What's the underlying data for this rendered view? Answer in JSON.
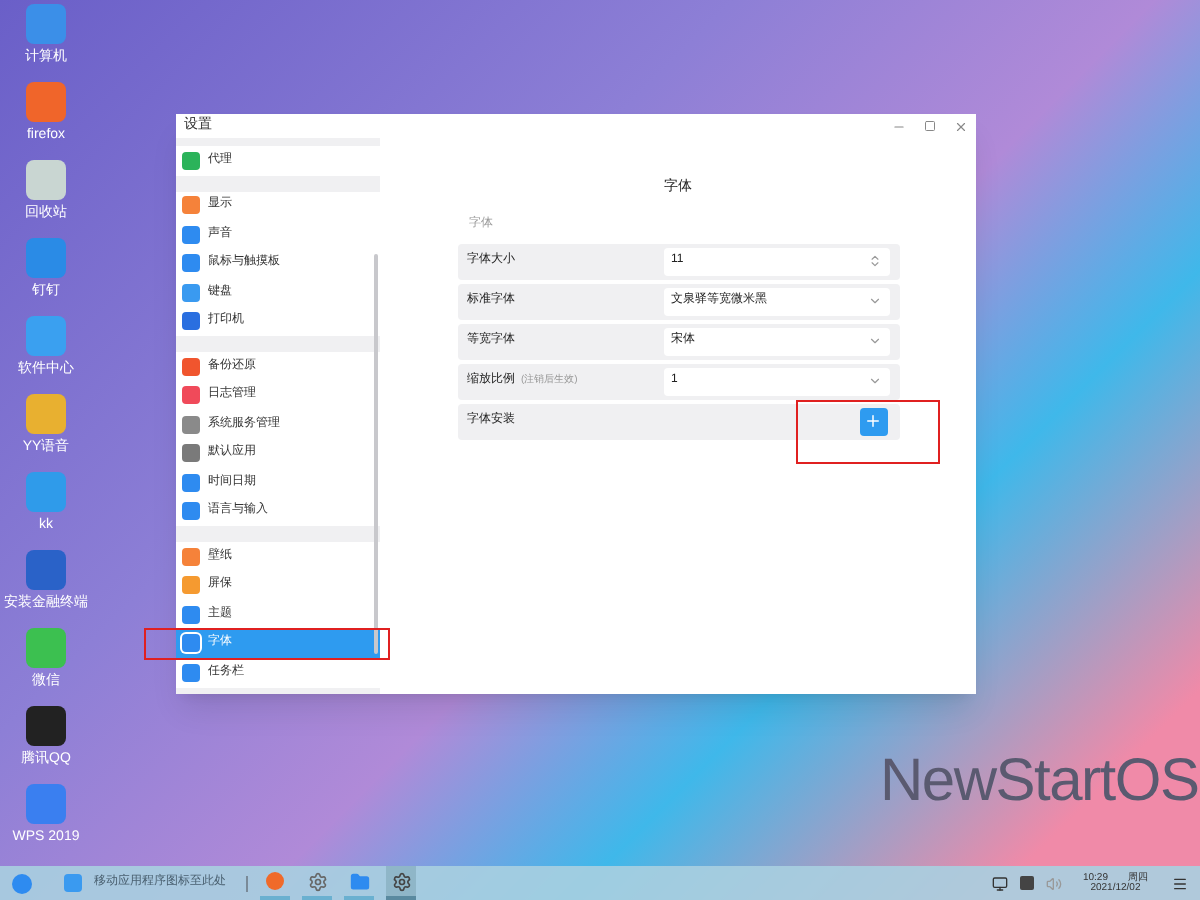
{
  "desktop_icons": [
    {
      "label": "计算机",
      "color": "#3b8fe8"
    },
    {
      "label": "firefox",
      "color": "#f0652a"
    },
    {
      "label": "回收站",
      "color": "#c9d6d2"
    },
    {
      "label": "钉钉",
      "color": "#2a8be6"
    },
    {
      "label": "软件中心",
      "color": "#3aa0f0"
    },
    {
      "label": "YY语音",
      "color": "#e8b030"
    },
    {
      "label": "kk",
      "color": "#2f9bea"
    },
    {
      "label": "安装金融终端",
      "color": "#2a62c8"
    },
    {
      "label": "微信",
      "color": "#3cc050"
    },
    {
      "label": "腾讯QQ",
      "color": "#222222"
    },
    {
      "label": "WPS 2019",
      "color": "#3a7ff0"
    }
  ],
  "wallpaper_text": "NewStartOS",
  "window": {
    "title": "设置",
    "sidebar": {
      "groups": [
        [
          {
            "label": "代理",
            "color": "#2bb35a",
            "selected": false
          }
        ],
        [
          {
            "label": "显示",
            "color": "#f5823a",
            "selected": false
          },
          {
            "label": "声音",
            "color": "#2e8bf0",
            "selected": false
          },
          {
            "label": "鼠标与触摸板",
            "color": "#2e8bf0",
            "selected": false
          },
          {
            "label": "键盘",
            "color": "#3a9af0",
            "selected": false
          },
          {
            "label": "打印机",
            "color": "#2a6fe0",
            "selected": false
          }
        ],
        [
          {
            "label": "备份还原",
            "color": "#f0552e",
            "selected": false
          },
          {
            "label": "日志管理",
            "color": "#f04a5a",
            "selected": false
          },
          {
            "label": "系统服务管理",
            "color": "#8a8a8a",
            "selected": false
          },
          {
            "label": "默认应用",
            "color": "#7a7a7a",
            "selected": false
          },
          {
            "label": "时间日期",
            "color": "#2e8bf0",
            "selected": false
          },
          {
            "label": "语言与输入",
            "color": "#2e8bf0",
            "selected": false
          }
        ],
        [
          {
            "label": "壁纸",
            "color": "#f5823a",
            "selected": false
          },
          {
            "label": "屏保",
            "color": "#f59a30",
            "selected": false
          },
          {
            "label": "主题",
            "color": "#2e8bf0",
            "selected": false
          },
          {
            "label": "字体",
            "color": "#2e8bf0",
            "selected": true
          },
          {
            "label": "任务栏",
            "color": "#2e8bf0",
            "selected": false
          }
        ]
      ]
    },
    "content": {
      "title": "字体",
      "section": "字体",
      "rows": [
        {
          "kind": "spin",
          "label": "字体大小",
          "value": "11"
        },
        {
          "kind": "select",
          "label": "标准字体",
          "value": "文泉驿等宽微米黑"
        },
        {
          "kind": "select",
          "label": "等宽字体",
          "value": "宋体"
        },
        {
          "kind": "select",
          "label": "缩放比例",
          "note": "(注销后生效)",
          "value": "1"
        },
        {
          "kind": "add",
          "label": "字体安装"
        }
      ]
    }
  },
  "taskbar": {
    "hint": "移动应用程序图标至此处",
    "apps": [
      {
        "selected": false
      },
      {
        "selected": false
      },
      {
        "selected": false
      },
      {
        "selected": true
      }
    ],
    "time": "10:29",
    "weekday": "周四",
    "date": "2021/12/02"
  }
}
